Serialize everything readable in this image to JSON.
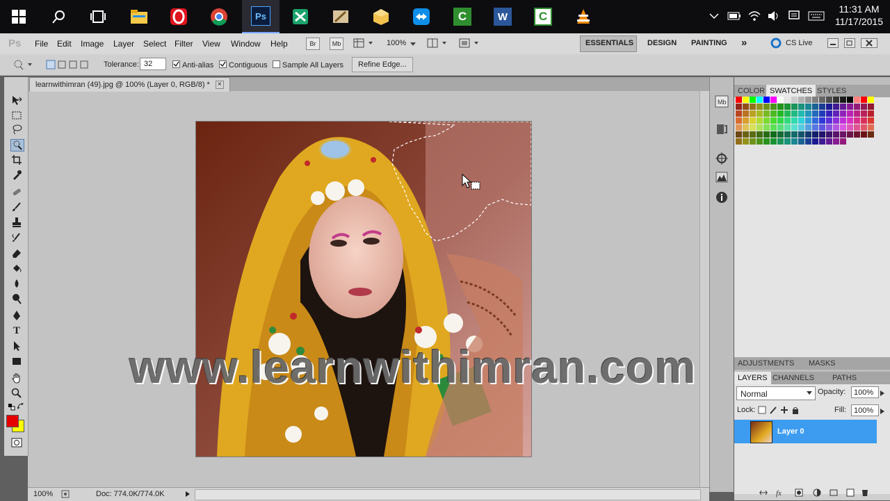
{
  "taskbar": {
    "clock_time": "11:31 AM",
    "clock_date": "11/17/2015",
    "apps": [
      {
        "name": "start-icon"
      },
      {
        "name": "search-icon"
      },
      {
        "name": "task-view-icon"
      },
      {
        "name": "file-explorer-icon"
      },
      {
        "name": "opera-icon"
      },
      {
        "name": "chrome-icon"
      },
      {
        "name": "photoshop-icon",
        "label": "Ps"
      },
      {
        "name": "app-green-icon"
      },
      {
        "name": "app-tools-icon"
      },
      {
        "name": "app-box-icon"
      },
      {
        "name": "teamviewer-icon"
      },
      {
        "name": "camtasia-icon",
        "label": "C"
      },
      {
        "name": "word-icon",
        "label": "W"
      },
      {
        "name": "camtasia-recorder-icon",
        "label": "C"
      },
      {
        "name": "vlc-icon"
      }
    ]
  },
  "appbar": {
    "logo": "Ps",
    "menus": [
      "File",
      "Edit",
      "Image",
      "Layer",
      "Select",
      "Filter",
      "View",
      "Window",
      "Help"
    ],
    "bridge_label": "Br",
    "minibridge_label": "Mb",
    "zoom_value": "100%",
    "workspaces": [
      "ESSENTIALS",
      "DESIGN",
      "PAINTING"
    ],
    "more": "»",
    "cs_live": "CS Live"
  },
  "options": {
    "tolerance_label": "Tolerance:",
    "tolerance_value": "32",
    "anti_alias_label": "Anti-alias",
    "contiguous_label": "Contiguous",
    "sample_all_label": "Sample All Layers",
    "refine_edge_label": "Refine Edge...",
    "anti_alias_checked": true,
    "contiguous_checked": true,
    "sample_all_checked": false
  },
  "document": {
    "tab_title": "learnwithimran (49).jpg @ 100% (Layer 0, RGB/8) *",
    "close_glyph": "×",
    "watermark": "www.learnwithimran.com"
  },
  "status": {
    "zoom": "100%",
    "doc_info": "Doc: 774.0K/774.0K"
  },
  "panels": {
    "color_tabs": [
      "COLOR",
      "SWATCHES",
      "STYLES"
    ],
    "adjust_tabs": [
      "ADJUSTMENTS",
      "MASKS"
    ],
    "layer_tabs": [
      "LAYERS",
      "CHANNELS",
      "PATHS"
    ],
    "blend_mode": "Normal",
    "opacity_label": "Opacity:",
    "opacity_value": "100%",
    "lock_label": "Lock:",
    "fill_label": "Fill:",
    "fill_value": "100%",
    "layer_name": "Layer 0"
  },
  "colors": {
    "foreground": "#e60000",
    "background": "#ffff00",
    "selection_accent": "#3d9cf0"
  }
}
